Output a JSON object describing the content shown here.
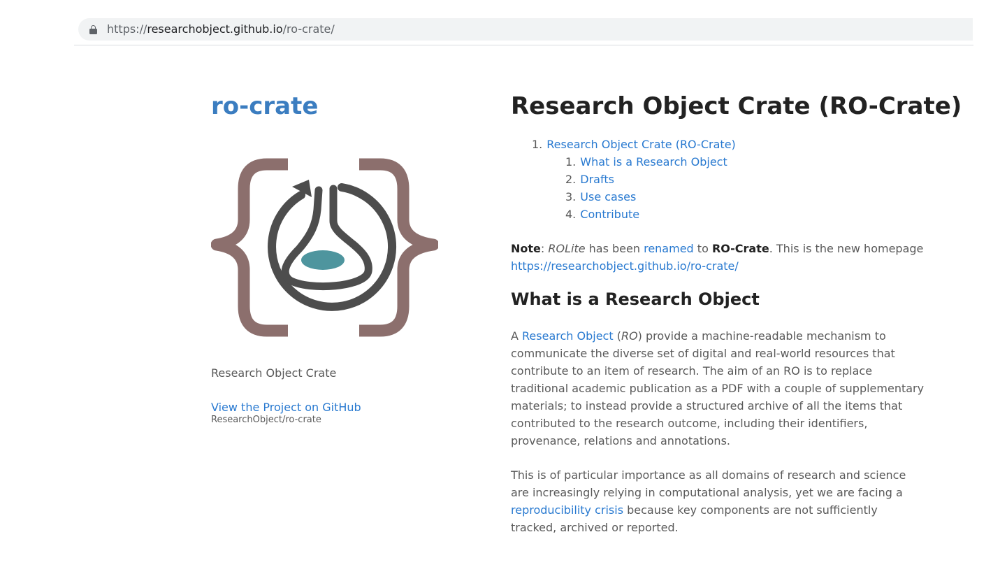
{
  "browser": {
    "url_scheme": "https://",
    "url_host": "researchobject.github.io",
    "url_path": "/ro-crate/"
  },
  "sidebar": {
    "site_title": "ro-crate",
    "logo_icon": "ro-crate-logo-icon",
    "tagline": "Research Object Crate",
    "github_link": "View the Project on GitHub",
    "github_repo": "ResearchObject/ro-crate"
  },
  "main": {
    "title": "Research Object Crate (RO-Crate)",
    "toc": {
      "top": {
        "num": "1.",
        "label": "Research Object Crate (RO-Crate)"
      },
      "sub": [
        {
          "num": "1.",
          "label": "What is a Research Object"
        },
        {
          "num": "2.",
          "label": "Drafts"
        },
        {
          "num": "3.",
          "label": "Use cases"
        },
        {
          "num": "4.",
          "label": "Contribute"
        }
      ]
    },
    "note": {
      "label": "Note",
      "sep": ": ",
      "rolite": "ROLite",
      "t1": " has been ",
      "renamed_link": "renamed",
      "t2": " to ",
      "rocrate": "RO-Crate",
      "t3": ". This is the new homepage ",
      "homepage_link": "https://researchobject.github.io/ro-crate/"
    },
    "section_title": "What is a Research Object",
    "p1": {
      "t1": "A ",
      "ro_link": "Research Object",
      "t2": " (",
      "ro_abbr": "RO",
      "t3": ") provide a machine-readable mechanism to communicate the diverse set of digital and real-world resources that contribute to an item of research. The aim of an RO is to replace traditional academic publication as a PDF with a couple of supplementary materials; to instead provide a structured archive of all the items that contributed to the research outcome, including their identifiers, provenance, relations and annotations."
    },
    "p2": {
      "t1": "This is of particular importance as all domains of research and science are increasingly relying in computational analysis, yet we are facing a ",
      "crisis_link": "reproducibility crisis",
      "t2": " because key components are not sufficiently tracked, archived or reported."
    }
  },
  "colors": {
    "link": "#2879d0",
    "title": "#3b7dc0",
    "logo_brace": "#8c6f6d",
    "logo_flask": "#4d4d4d",
    "logo_liquid": "#4e959e"
  }
}
